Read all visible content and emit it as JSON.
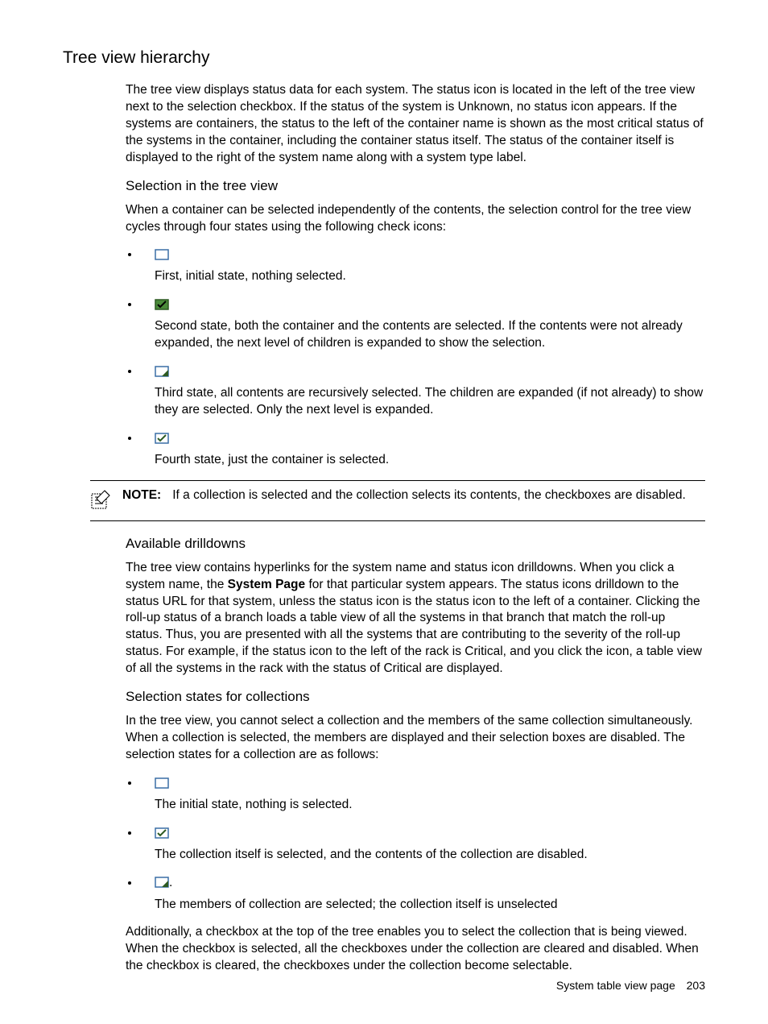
{
  "title": "Tree view hierarchy",
  "intro": "The tree view displays status data for each system. The status icon is located in the left of the tree view next to the selection checkbox. If the status of the system is Unknown, no status icon appears. If the systems are containers, the status to the left of the container name is shown as the most critical status of the systems in the container, including the container status itself. The status of the container itself is displayed to the right of the system name along with a system type label.",
  "sub1": {
    "heading": "Selection in the tree view",
    "lead": "When a container can be selected independently of the contents, the selection control for the tree view cycles through four states using the following check icons:",
    "states": [
      "First, initial state, nothing selected.",
      "Second state, both the container and the contents are selected. If the contents were not already expanded, the next level of children is expanded to show the selection.",
      "Third state, all contents are recursively selected. The children are expanded (if not already) to show they are selected. Only the next level is expanded.",
      "Fourth state, just the container is selected."
    ]
  },
  "note": {
    "label": "NOTE:",
    "text": "If a collection is selected and the collection selects its contents, the checkboxes are disabled."
  },
  "sub2": {
    "heading": "Available drilldowns",
    "p1a": "The tree view contains hyperlinks for the system name and status icon drilldowns. When you click a system name, the ",
    "p1b": "System Page",
    "p1c": " for that particular system appears. The status icons drilldown to the status URL for that system, unless the status icon is the status icon to the left of a container. Clicking the roll-up status of a branch loads a table view of all the systems in that branch that match the roll-up status. Thus, you are presented with all the systems that are contributing to the severity of the roll-up status. For example, if the status icon to the left of the rack is Critical, and you click the icon, a table view of all the systems in the rack with the status of Critical are displayed."
  },
  "sub3": {
    "heading": "Selection states for collections",
    "lead": "In the tree view, you cannot select a collection and the members of the same collection simultaneously. When a collection is selected, the members are displayed and their selection boxes are disabled. The selection states for a collection are as follows:",
    "states": [
      "The initial state, nothing is selected.",
      "The collection itself is selected, and the contents of the collection are disabled.",
      "The members of collection are selected; the collection itself is unselected"
    ],
    "tail": "Additionally, a checkbox at the top of the tree enables you to select the collection that is being viewed. When the checkbox is selected, all the checkboxes under the collection are cleared and disabled. When the checkbox is cleared, the checkboxes under the collection become selectable."
  },
  "footer": {
    "label": "System table view page",
    "page": "203"
  }
}
